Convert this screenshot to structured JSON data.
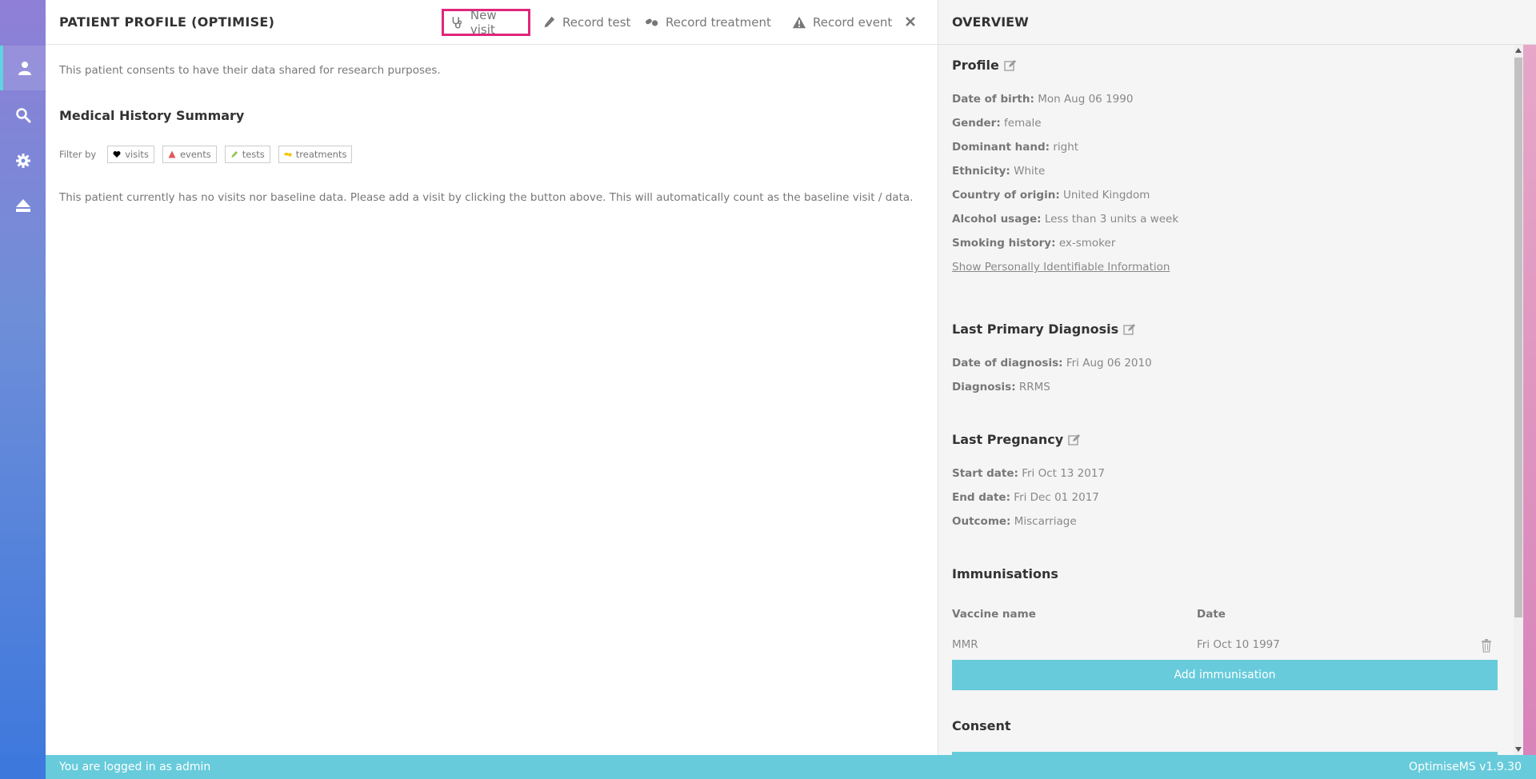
{
  "header": {
    "title": "PATIENT PROFILE (OPTIMISE)",
    "actions": [
      {
        "label": "New visit",
        "icon": "stethoscope-icon"
      },
      {
        "label": "Record test",
        "icon": "eyedropper-icon"
      },
      {
        "label": "Record treatment",
        "icon": "pills-icon"
      },
      {
        "label": "Record event",
        "icon": "warning-icon"
      }
    ]
  },
  "main": {
    "consent_text": "This patient consents to have their data shared for research purposes.",
    "section_title": "Medical History Summary",
    "filter": {
      "label": "Filter by",
      "chips": [
        {
          "label": "visits",
          "icon": "heart-icon",
          "color": "#000000"
        },
        {
          "label": "events",
          "icon": "warning-icon",
          "color": "#e05a5a"
        },
        {
          "label": "tests",
          "icon": "eyedropper-icon",
          "color": "#8bc34a"
        },
        {
          "label": "treatments",
          "icon": "pills-icon",
          "color": "#f5c400"
        }
      ]
    },
    "no_visit_text": "This patient currently has no visits nor baseline data. Please add a visit by clicking the button above. This will automatically count as the baseline visit / data."
  },
  "overview": {
    "title": "OVERVIEW",
    "profile": {
      "title": "Profile",
      "rows": [
        {
          "label": "Date of birth:",
          "value": "Mon Aug 06 1990"
        },
        {
          "label": "Gender:",
          "value": "female"
        },
        {
          "label": "Dominant hand:",
          "value": "right"
        },
        {
          "label": "Ethnicity:",
          "value": "White"
        },
        {
          "label": "Country of origin:",
          "value": "United Kingdom"
        },
        {
          "label": "Alcohol usage:",
          "value": "Less than 3 units a week"
        },
        {
          "label": "Smoking history:",
          "value": "ex-smoker"
        }
      ],
      "pii_link": "Show Personally Identifiable Information"
    },
    "diagnosis": {
      "title": "Last Primary Diagnosis",
      "rows": [
        {
          "label": "Date of diagnosis:",
          "value": "Fri Aug 06 2010"
        },
        {
          "label": "Diagnosis:",
          "value": "RRMS"
        }
      ]
    },
    "pregnancy": {
      "title": "Last Pregnancy",
      "rows": [
        {
          "label": "Start date:",
          "value": "Fri Oct 13 2017"
        },
        {
          "label": "End date:",
          "value": "Fri Dec 01 2017"
        },
        {
          "label": "Outcome:",
          "value": "Miscarriage"
        }
      ]
    },
    "immunisations": {
      "title": "Immunisations",
      "columns": [
        "Vaccine name",
        "Date"
      ],
      "rows": [
        {
          "vaccine": "MMR",
          "date": "Fri Oct 10 1997"
        }
      ],
      "add_label": "Add immunisation"
    },
    "consent": {
      "title": "Consent"
    }
  },
  "footer": {
    "logged_in": "You are logged in as admin",
    "version": "OptimiseMS v1.9.30"
  },
  "colors": {
    "accent": "#67cbdb",
    "highlight": "#e0267c"
  }
}
